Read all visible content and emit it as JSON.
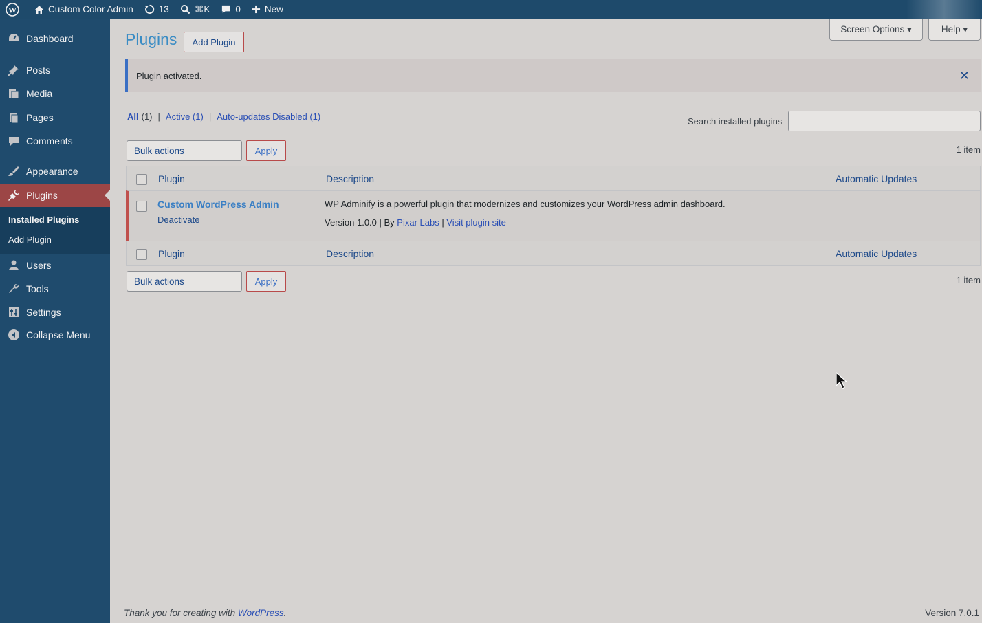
{
  "adminbar": {
    "site_name": "Custom Color Admin",
    "updates_count": "13",
    "search_shortcut": "⌘K",
    "comments_count": "0",
    "new_label": "New"
  },
  "sidebar": {
    "items": [
      {
        "label": "Dashboard",
        "icon": "dashboard-icon"
      },
      {
        "label": "Posts",
        "icon": "pin-icon"
      },
      {
        "label": "Media",
        "icon": "media-icon"
      },
      {
        "label": "Pages",
        "icon": "pages-icon"
      },
      {
        "label": "Comments",
        "icon": "comment-icon"
      },
      {
        "label": "Appearance",
        "icon": "brush-icon"
      },
      {
        "label": "Plugins",
        "icon": "plugin-icon"
      },
      {
        "label": "Users",
        "icon": "users-icon"
      },
      {
        "label": "Tools",
        "icon": "wrench-icon"
      },
      {
        "label": "Settings",
        "icon": "settings-icon"
      },
      {
        "label": "Collapse Menu",
        "icon": "collapse-icon"
      }
    ],
    "submenu": {
      "installed": "Installed Plugins",
      "add": "Add Plugin"
    }
  },
  "header": {
    "title": "Plugins",
    "add_plugin": "Add Plugin",
    "screen_options": "Screen Options ▾",
    "help": "Help ▾"
  },
  "notice": {
    "text": "Plugin activated.",
    "dismiss": "✕"
  },
  "filters": {
    "all": "All",
    "all_count": "(1)",
    "active": "Active (1)",
    "auto_updates_disabled": "Auto-updates Disabled (1)"
  },
  "search": {
    "label": "Search installed plugins",
    "value": ""
  },
  "bulk": {
    "select_label": "Bulk actions",
    "apply": "Apply",
    "count": "1 item"
  },
  "table": {
    "columns": {
      "plugin": "Plugin",
      "description": "Description",
      "auto_updates": "Automatic Updates"
    },
    "rows": [
      {
        "name": "Custom WordPress Admin",
        "action": "Deactivate",
        "description": "WP Adminify is a powerful plugin that modernizes and customizes your WordPress admin dashboard.",
        "version": "Version 1.0.0 | By",
        "author": "Pixar Labs",
        "sep": "|",
        "site_link": "Visit plugin site"
      }
    ]
  },
  "footer": {
    "thanks_prefix": "Thank you for creating with",
    "thanks_link": "WordPress",
    "thanks_suffix": ".",
    "version": "Version 7.0.1"
  },
  "colors": {
    "admin_bar": "#1e4a6b",
    "sidebar": "#1f4b6d",
    "current_menu": "#9c4646",
    "link": "#2a4fb5",
    "background": "#d6d3d1"
  }
}
